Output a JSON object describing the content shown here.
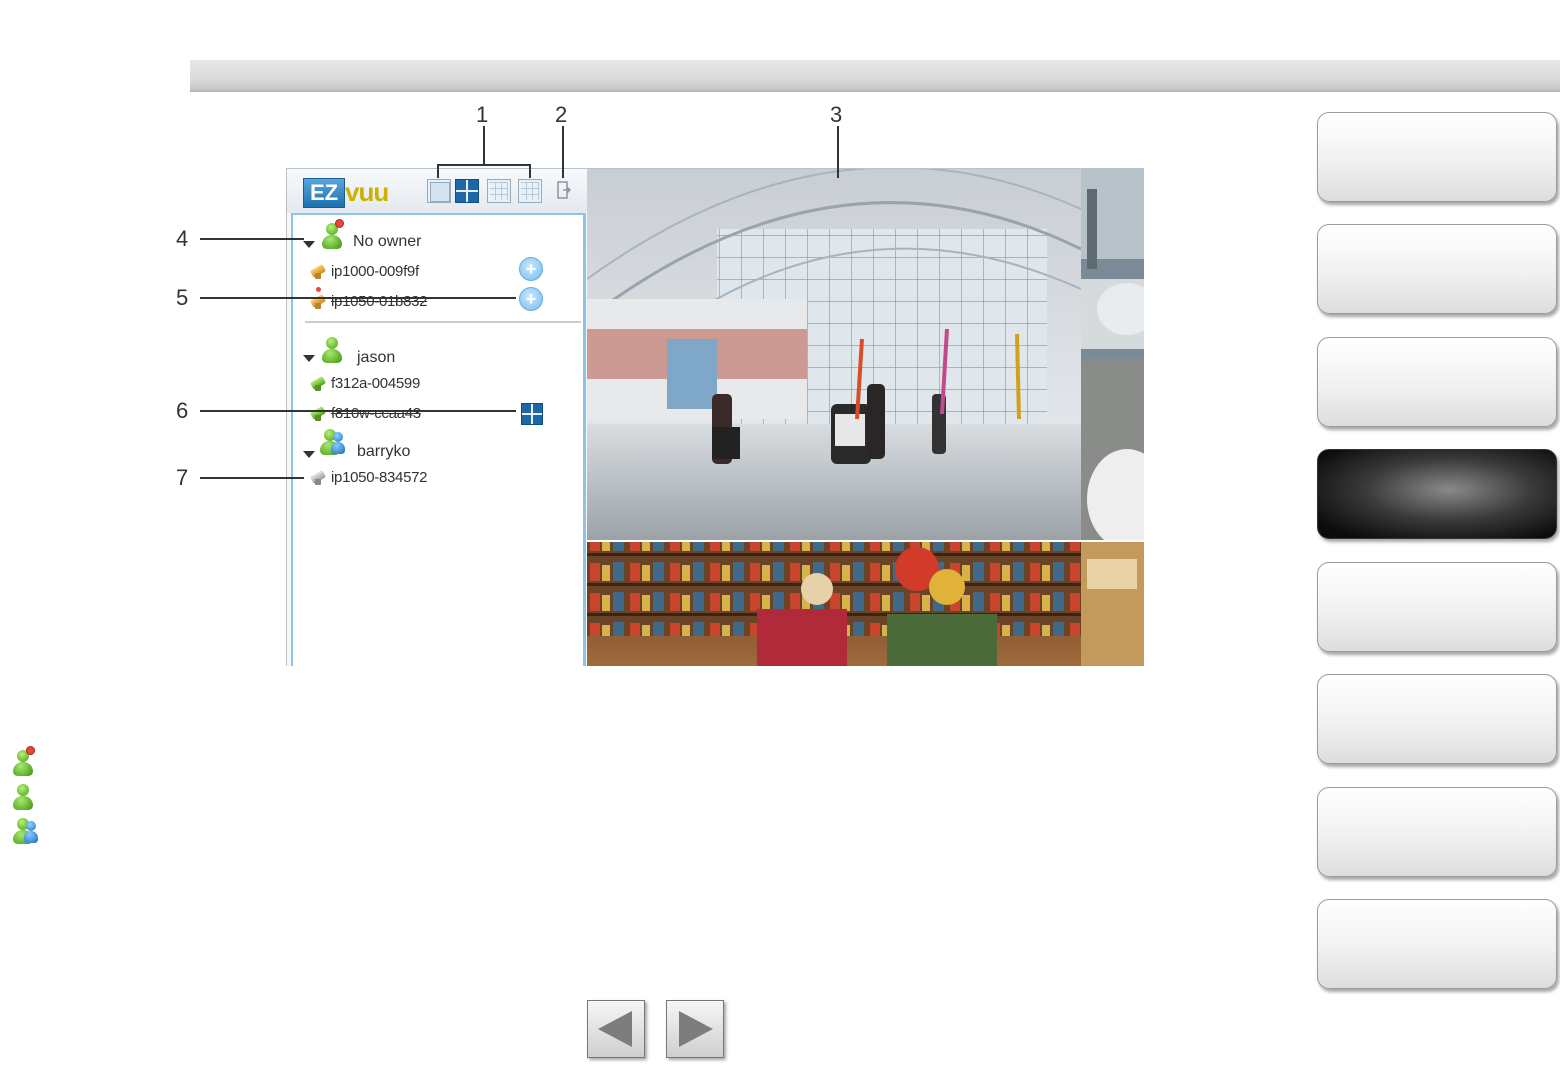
{
  "callouts": [
    "1",
    "2",
    "3",
    "4",
    "5",
    "6",
    "7"
  ],
  "app": {
    "logo": {
      "ez": "EZ",
      "vuu": "vuu"
    },
    "tree": {
      "groups": [
        {
          "owner": "No owner",
          "cameras": [
            "ip1000-009f9f",
            "ip1050-01b832"
          ]
        },
        {
          "owner": "jason",
          "cameras": [
            "f312a-004599",
            "f810w-ccaa43"
          ]
        },
        {
          "owner": "barryko",
          "cameras": [
            "ip1050-834572"
          ]
        }
      ]
    }
  },
  "legend_icons": [
    "user-pin-icon",
    "user-icon",
    "user-group-icon"
  ],
  "colors": {
    "accent": "#1b67a8",
    "panel_border": "#8ec3e8",
    "active_nav": "#1a1a1a"
  }
}
